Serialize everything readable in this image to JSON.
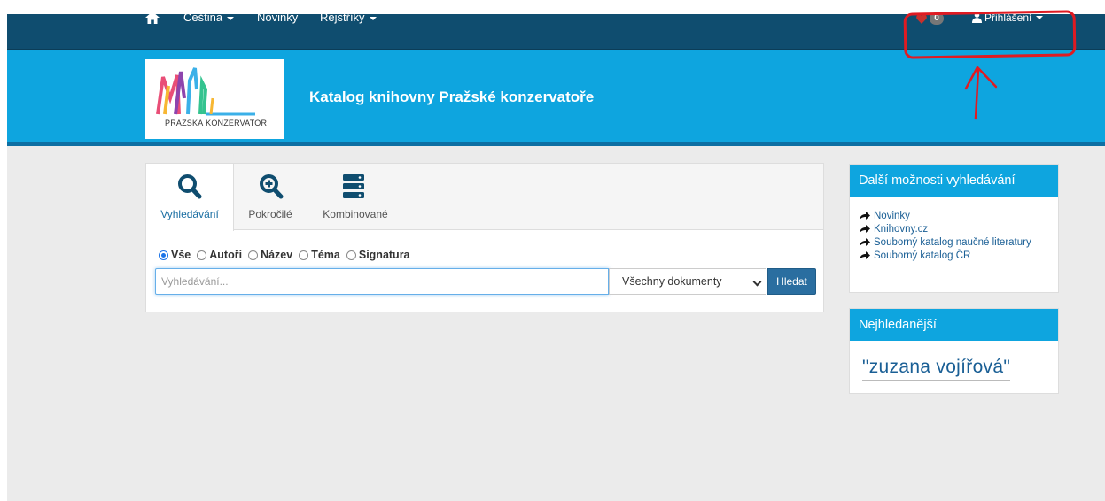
{
  "nav": {
    "language_label": "Čeština",
    "news_label": "Novinky",
    "registers_label": "Rejstříky",
    "favorites_count": "0",
    "login_label": "Přihlášení"
  },
  "header": {
    "logo_text": "PRAŽSKÁ KONZERVATOŘ",
    "title": "Katalog knihovny Pražské konzervatoře"
  },
  "search": {
    "tabs": [
      {
        "label": "Vyhledávání",
        "icon": "search-icon"
      },
      {
        "label": "Pokročilé",
        "icon": "zoom-in-icon"
      },
      {
        "label": "Kombinované",
        "icon": "server-stack-icon"
      }
    ],
    "scopes": [
      {
        "label": "Vše",
        "checked": true
      },
      {
        "label": "Autoři",
        "checked": false
      },
      {
        "label": "Název",
        "checked": false
      },
      {
        "label": "Téma",
        "checked": false
      },
      {
        "label": "Signatura",
        "checked": false
      }
    ],
    "placeholder": "Vyhledávání...",
    "doc_type_selected": "Všechny dokumenty",
    "button_label": "Hledat"
  },
  "sidebar": {
    "more_options_title": "Další možnosti vyhledávání",
    "links": [
      "Novinky",
      "Knihovny.cz",
      "Souborný katalog naučné literatury",
      "Souborný katalog ČR"
    ],
    "popular_title": "Nejhledanější",
    "popular_query": "\"zuzana vojířová\""
  },
  "colors": {
    "navbar": "#0f4d6f",
    "banner": "#0ea5df",
    "accent_link": "#1a5f95",
    "annotation_red": "#e01b22"
  }
}
